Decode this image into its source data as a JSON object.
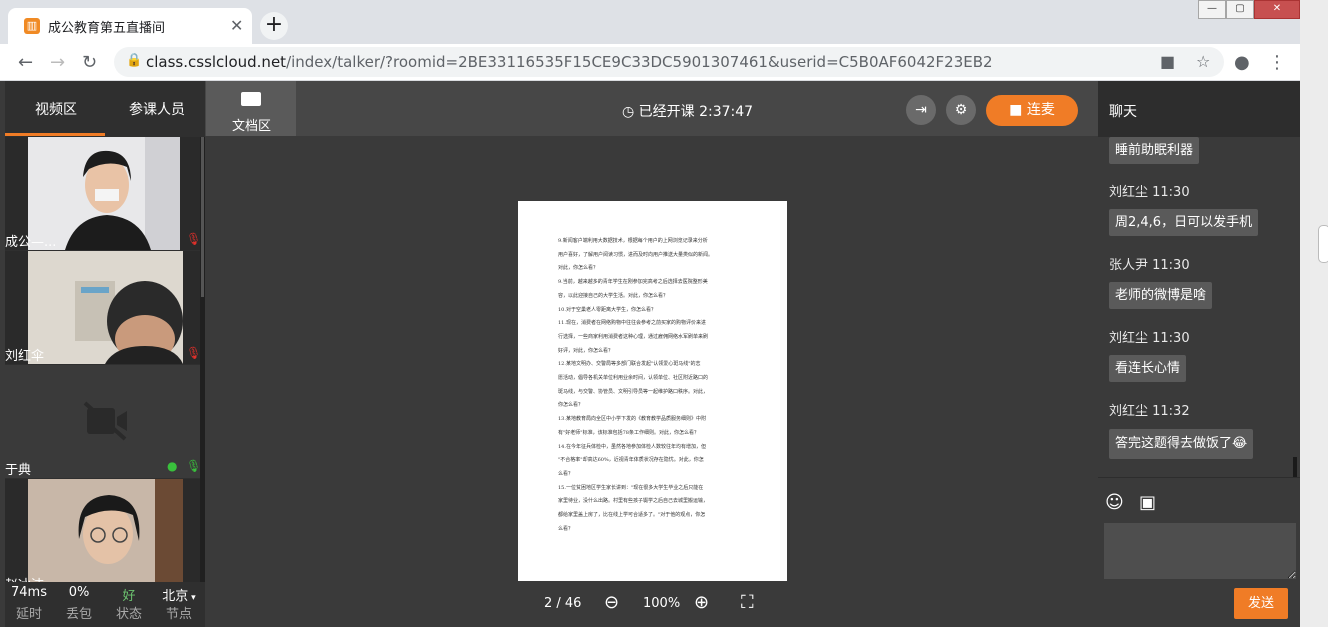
{
  "browser": {
    "tab_title": "成公教育第五直播间",
    "tab_close": "✕",
    "new_tab": "+",
    "url_host": "class.csslcloud.net",
    "url_path": "/index/talker/?roomid=2BE33116535F15CE9C33DC5901307461&userid=C5B0AF6042F23EB2",
    "win_min": "—",
    "win_max": "▢",
    "win_close": "✕"
  },
  "left_panel": {
    "tab_video": "视频区",
    "tab_members": "参课人员",
    "videos": [
      {
        "name": "成公—..."
      },
      {
        "name": "刘红伞"
      },
      {
        "name": "于典"
      },
      {
        "name": "赵冰洁"
      }
    ],
    "stats": [
      {
        "value": "74ms",
        "label": "延时"
      },
      {
        "value": "0%",
        "label": "丢包"
      },
      {
        "value": "好",
        "label": "状态"
      },
      {
        "value": "北京",
        "label": "节点"
      }
    ]
  },
  "topbar": {
    "doc_tab": "文档区",
    "timer": "已经开课 2:37:47",
    "lianmai": "连麦"
  },
  "document": {
    "lines": [
      "9.新闻客户端利用大数据技术，根据每个用户的上网浏览记录来分析",
      "用户喜好，了解用户阅读习惯，进而及时向用户推送大量类似的新闻。",
      "对此，你怎么看？",
      "9.当前，越来越多的青年学生在刚参加完高考之后选择去医院整形美",
      "容，以此迎接自己的大学生活。对此，你怎么看？",
      "10.对于空巢老人零距离大学生，你怎么看？",
      "11.现在，消费者在网络购物中往往会参考之前买家的购物评价来进",
      "行选择，一些商家利用消费者这种心理，通过雇佣网络水军刷单来刷",
      "好评，对此，你怎么看？",
      "12.某地文明办、交警局等多部门联合发起\"认领爱心斑马线\"的志",
      "愿活动，倡导各机关单位利用业余时间，认领单位、社区附近路口的",
      "斑马线，与交警、协管员、文明引导员等一起维护路口秩序。对此，",
      "你怎么看？",
      "13.某地教育局向全区中小学下发的《教育教学品质服务细则》中附",
      "有\"好老师\"标准，该标准包括78条工作细则。对此，你怎么看？",
      "14.在今年征兵体检中，虽然各地参加体检人数较往年均有增加，但",
      "\"不合格率\"却高达60%，近视青年体质状况存在隐忧。对此，你怎",
      "么看？",
      "15.一位贫困地区学生家长讲到：\"现在很多大学生毕业之后只能在",
      "家里待业，没什么出路。村里有些孩子辍学之后自己去城里搬运输，",
      "都给家里盖上房了，比在线上学可合适多了。\"对于他的观点，你怎",
      "么看？"
    ],
    "page": "2 / 46",
    "zoom": "100%"
  },
  "chat": {
    "title": "聊天",
    "messages": [
      {
        "name": "",
        "text": "睡前助眠利器"
      },
      {
        "name": "刘红尘 11:30",
        "text": "周2,4,6，日可以发手机"
      },
      {
        "name": "张人尹 11:30",
        "text": "老师的微博是啥"
      },
      {
        "name": "刘红尘 11:30",
        "text": "看连长心情"
      },
      {
        "name": "刘红尘 11:32",
        "text": "答完这题得去做饭了😂"
      }
    ],
    "send": "发送"
  },
  "colors": {
    "accent": "#f07c26"
  }
}
